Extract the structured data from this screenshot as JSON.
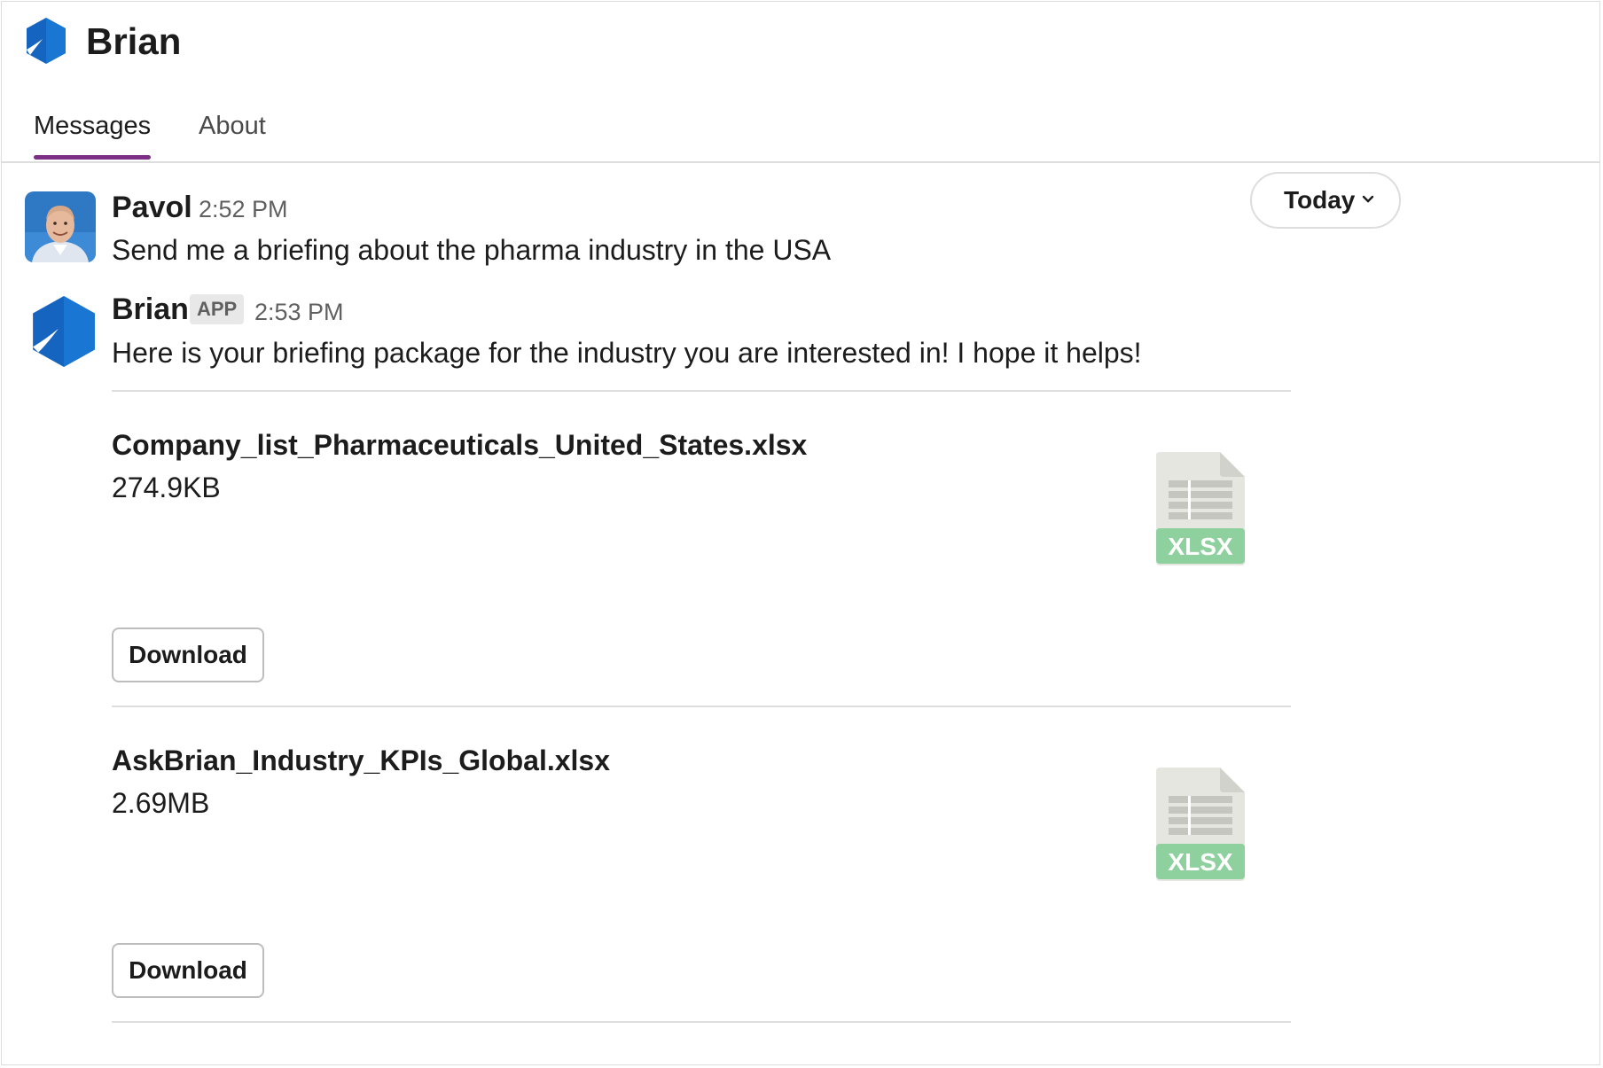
{
  "header": {
    "title": "Brian",
    "tabs": [
      {
        "label": "Messages",
        "active": true
      },
      {
        "label": "About",
        "active": false
      }
    ]
  },
  "date_divider": {
    "label": "Today"
  },
  "messages": [
    {
      "author": "Pavol",
      "time": "2:52 PM",
      "text": "Send me a briefing about the pharma industry in the USA"
    },
    {
      "author": "Brian",
      "badge": "APP",
      "time": "2:53 PM",
      "text": "Here is your briefing package for the industry you are interested in! I hope it helps!",
      "attachments": [
        {
          "name": "Company_list_Pharmaceuticals_United_States.xlsx",
          "size": "274.9KB",
          "type_label": "XLSX",
          "button": "Download"
        },
        {
          "name": "AskBrian_Industry_KPIs_Global.xlsx",
          "size": "2.69MB",
          "type_label": "XLSX",
          "button": "Download"
        }
      ]
    }
  ],
  "colors": {
    "brand_blue": "#1565c0",
    "tab_accent": "#7c3085",
    "xlsx_green": "#8fd19e"
  },
  "icons": {
    "app_logo": "hexagon-logo-icon",
    "dropdown": "chevron-down-icon",
    "file": "xlsx-file-icon"
  }
}
